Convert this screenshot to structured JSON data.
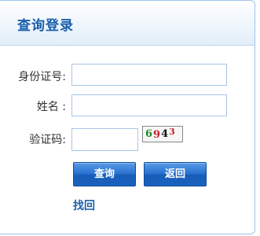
{
  "header": {
    "title": "查询登录"
  },
  "form": {
    "id_label": "身份证号:",
    "id_value": "",
    "name_label": "姓名 :",
    "name_value": "",
    "captcha_label": "验证码:",
    "captcha_value": "",
    "captcha_image": {
      "digits": [
        "6",
        "9",
        "4",
        "3"
      ]
    }
  },
  "buttons": {
    "query_label": "查询",
    "back_label": "返回"
  },
  "links": {
    "retrieve_label": "找回"
  },
  "colors": {
    "accent": "#1a5faa",
    "button": "#2b73d2",
    "border": "#a9c6e6"
  }
}
